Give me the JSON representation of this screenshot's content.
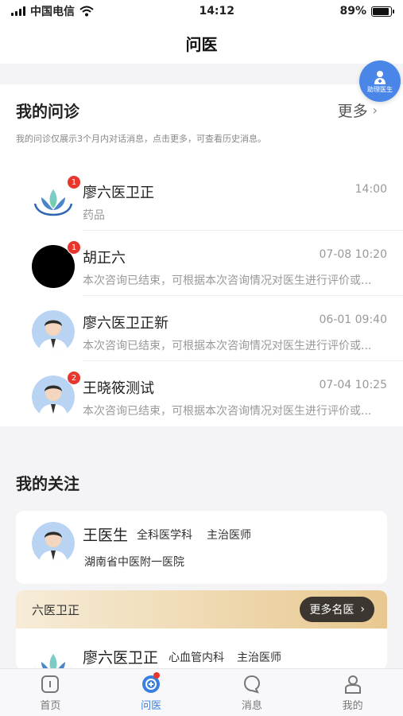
{
  "status_bar": {
    "carrier": "中国电信",
    "time": "14:12",
    "battery": "89%",
    "battery_level": 0.89
  },
  "nav": {
    "title": "问医"
  },
  "fab": {
    "label": "助理医生",
    "icon": "doctor-assistant-icon"
  },
  "consult": {
    "title": "我的问诊",
    "more_label": "更多",
    "note": "我的问诊仅展示3个月内对话消息，点击更多，可查看历史消息。",
    "items": [
      {
        "name": "廖六医卫正",
        "time": "14:00",
        "sub": "药品",
        "badge": "1",
        "avatar": "lotus-logo"
      },
      {
        "name": "胡正六",
        "time": "07-08 10:20",
        "sub": "本次咨询已结束，可根据本次咨询情况对医生进行评价或...",
        "badge": "1",
        "avatar": "black-circle"
      },
      {
        "name": "廖六医卫正新",
        "time": "06-01 09:40",
        "sub": "本次咨询已结束，可根据本次咨询情况对医生进行评价或...",
        "badge": "",
        "avatar": "doctor-avatar"
      },
      {
        "name": "王晓筱测试",
        "time": "07-04 10:25",
        "sub": "本次咨询已结束，可根据本次咨询情况对医生进行评价或...",
        "badge": "2",
        "avatar": "doctor-avatar"
      }
    ]
  },
  "follow": {
    "title": "我的关注",
    "doctor": {
      "name": "王医生",
      "dept": "全科医学科",
      "title": "主治医师",
      "hospital": "湖南省中医附一医院"
    },
    "team": {
      "name": "六医卫正",
      "more_label": "更多名医",
      "doctor": {
        "name": "廖六医卫正",
        "dept": "心血管内科",
        "title": "主治医师"
      }
    }
  },
  "tabbar": [
    {
      "label": "首页",
      "icon": "home-icon",
      "active": false
    },
    {
      "label": "问医",
      "icon": "ask-doctor-icon",
      "active": true
    },
    {
      "label": "消息",
      "icon": "message-icon",
      "active": false
    },
    {
      "label": "我的",
      "icon": "profile-icon",
      "active": false
    }
  ],
  "colors": {
    "accent": "#3a7fe0",
    "badge": "#e8362e",
    "team_dark": "#3b3630"
  }
}
